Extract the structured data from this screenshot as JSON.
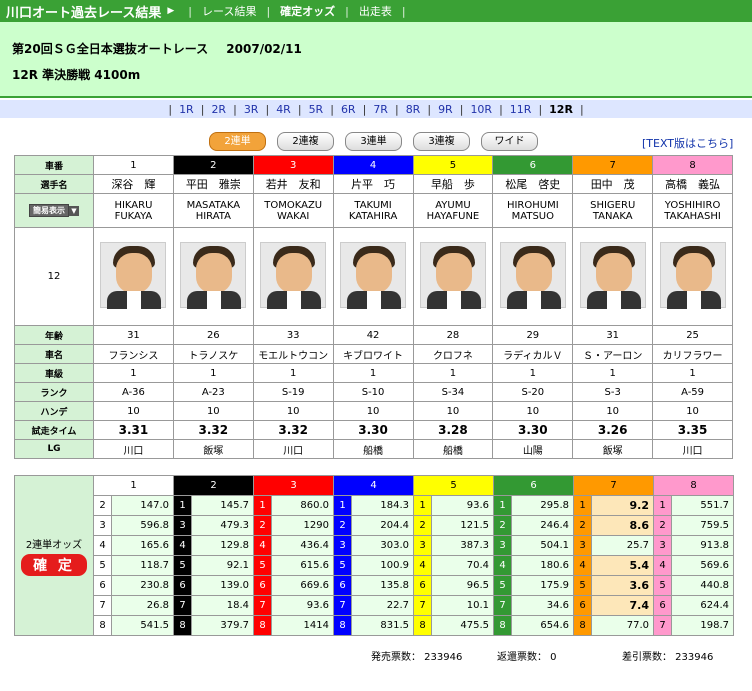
{
  "topbar": {
    "title": "川口オート過去レース結果",
    "arrow": "▶",
    "nav": [
      {
        "label": "レース結果",
        "active": false
      },
      {
        "label": "確定オッズ",
        "active": true
      },
      {
        "label": "出走表",
        "active": false
      }
    ]
  },
  "header": {
    "race_name": "第20回ＳＧ全日本選抜オートレース",
    "date": "2007/02/11",
    "race_info": "12R 準決勝戦 4100m"
  },
  "races": [
    "1R",
    "2R",
    "3R",
    "4R",
    "5R",
    "6R",
    "7R",
    "8R",
    "9R",
    "10R",
    "11R",
    "12R"
  ],
  "active_race": "12R",
  "tabs": [
    {
      "label": "2連単",
      "active": true
    },
    {
      "label": "2連複",
      "active": false
    },
    {
      "label": "3連単",
      "active": false
    },
    {
      "label": "3連複",
      "active": false
    },
    {
      "label": "ワイド",
      "active": false
    }
  ],
  "text_link": "[TEXT版はこちら]",
  "labels": {
    "car": "車番",
    "name": "選手名",
    "easy": "簡易表示",
    "easy_btn": "▼",
    "race_no": "12",
    "age": "年齢",
    "bike": "車名",
    "class": "車級",
    "rank": "ランク",
    "handicap": "ハンデ",
    "time": "試走タイム",
    "lg": "LG",
    "odds_label": "2連単オッズ",
    "kakutei": "確 定"
  },
  "colors": {
    "1": {
      "bg": "#ffffff",
      "fg": "#000000"
    },
    "2": {
      "bg": "#000000",
      "fg": "#ffffff"
    },
    "3": {
      "bg": "#ff0000",
      "fg": "#ffffff"
    },
    "4": {
      "bg": "#0000ff",
      "fg": "#ffffff"
    },
    "5": {
      "bg": "#ffff00",
      "fg": "#000000"
    },
    "6": {
      "bg": "#339933",
      "fg": "#ffffff"
    },
    "7": {
      "bg": "#ff9900",
      "fg": "#000000"
    },
    "8": {
      "bg": "#ff99cc",
      "fg": "#000000"
    }
  },
  "riders": [
    {
      "no": "1",
      "name": "深谷　輝",
      "romaji1": "HIKARU",
      "romaji2": "FUKAYA",
      "age": "31",
      "bike": "フランシス",
      "class": "1",
      "rank": "A-36",
      "handicap": "10",
      "time": "3.31",
      "lg": "川口"
    },
    {
      "no": "2",
      "name": "平田　雅崇",
      "romaji1": "MASATAKA",
      "romaji2": "HIRATA",
      "age": "26",
      "bike": "トラノスケ",
      "class": "1",
      "rank": "A-23",
      "handicap": "10",
      "time": "3.32",
      "lg": "飯塚"
    },
    {
      "no": "3",
      "name": "若井　友和",
      "romaji1": "TOMOKAZU",
      "romaji2": "WAKAI",
      "age": "33",
      "bike": "モエルトウコン",
      "class": "1",
      "rank": "S-19",
      "handicap": "10",
      "time": "3.32",
      "lg": "川口"
    },
    {
      "no": "4",
      "name": "片平　巧",
      "romaji1": "TAKUMI",
      "romaji2": "KATAHIRA",
      "age": "42",
      "bike": "キブロワイト",
      "class": "1",
      "rank": "S-10",
      "handicap": "10",
      "time": "3.30",
      "lg": "船橋"
    },
    {
      "no": "5",
      "name": "早船　歩",
      "romaji1": "AYUMU",
      "romaji2": "HAYAFUNE",
      "age": "28",
      "bike": "クロフネ",
      "class": "1",
      "rank": "S-34",
      "handicap": "10",
      "time": "3.28",
      "lg": "船橋"
    },
    {
      "no": "6",
      "name": "松尾　啓史",
      "romaji1": "HIROHUMI",
      "romaji2": "MATSUO",
      "age": "29",
      "bike": "ラディカルＶ",
      "class": "1",
      "rank": "S-20",
      "handicap": "10",
      "time": "3.30",
      "lg": "山陽"
    },
    {
      "no": "7",
      "name": "田中　茂",
      "romaji1": "SHIGERU",
      "romaji2": "TANAKA",
      "age": "31",
      "bike": "Ｓ・アーロン",
      "class": "1",
      "rank": "S-3",
      "handicap": "10",
      "time": "3.26",
      "lg": "飯塚"
    },
    {
      "no": "8",
      "name": "高橋　義弘",
      "romaji1": "YOSHIHIRO",
      "romaji2": "TAKAHASHI",
      "age": "25",
      "bike": "カリフラワー",
      "class": "1",
      "rank": "A-59",
      "handicap": "10",
      "time": "3.35",
      "lg": "川口"
    }
  ],
  "odds": [
    {
      "first": "1",
      "cells": [
        {
          "second": "2",
          "value": "147.0"
        },
        {
          "second": "3",
          "value": "596.8"
        },
        {
          "second": "4",
          "value": "165.6"
        },
        {
          "second": "5",
          "value": "118.7"
        },
        {
          "second": "6",
          "value": "230.8"
        },
        {
          "second": "7",
          "value": "26.8"
        },
        {
          "second": "8",
          "value": "541.5"
        }
      ]
    },
    {
      "first": "2",
      "cells": [
        {
          "second": "1",
          "value": "145.7"
        },
        {
          "second": "3",
          "value": "479.3"
        },
        {
          "second": "4",
          "value": "129.8"
        },
        {
          "second": "5",
          "value": "92.1"
        },
        {
          "second": "6",
          "value": "139.0"
        },
        {
          "second": "7",
          "value": "18.4"
        },
        {
          "second": "8",
          "value": "379.7"
        }
      ]
    },
    {
      "first": "3",
      "cells": [
        {
          "second": "1",
          "value": "860.0"
        },
        {
          "second": "2",
          "value": "1290"
        },
        {
          "second": "4",
          "value": "436.4"
        },
        {
          "second": "5",
          "value": "615.6"
        },
        {
          "second": "6",
          "value": "669.6"
        },
        {
          "second": "7",
          "value": "93.6"
        },
        {
          "second": "8",
          "value": "1414"
        }
      ]
    },
    {
      "first": "4",
      "cells": [
        {
          "second": "1",
          "value": "184.3"
        },
        {
          "second": "2",
          "value": "204.4"
        },
        {
          "second": "3",
          "value": "303.0"
        },
        {
          "second": "5",
          "value": "100.9"
        },
        {
          "second": "6",
          "value": "135.8"
        },
        {
          "second": "7",
          "value": "22.7"
        },
        {
          "second": "8",
          "value": "831.5"
        }
      ]
    },
    {
      "first": "5",
      "cells": [
        {
          "second": "1",
          "value": "93.6"
        },
        {
          "second": "2",
          "value": "121.5"
        },
        {
          "second": "3",
          "value": "387.3"
        },
        {
          "second": "4",
          "value": "70.4"
        },
        {
          "second": "6",
          "value": "96.5"
        },
        {
          "second": "7",
          "value": "10.1"
        },
        {
          "second": "8",
          "value": "475.5"
        }
      ]
    },
    {
      "first": "6",
      "cells": [
        {
          "second": "1",
          "value": "295.8"
        },
        {
          "second": "2",
          "value": "246.4"
        },
        {
          "second": "3",
          "value": "504.1"
        },
        {
          "second": "4",
          "value": "180.6"
        },
        {
          "second": "5",
          "value": "175.9"
        },
        {
          "second": "7",
          "value": "34.6"
        },
        {
          "second": "8",
          "value": "654.6"
        }
      ]
    },
    {
      "first": "7",
      "cells": [
        {
          "second": "1",
          "value": "9.2",
          "hl": true
        },
        {
          "second": "2",
          "value": "8.6",
          "hl": true
        },
        {
          "second": "3",
          "value": "25.7"
        },
        {
          "second": "4",
          "value": "5.4",
          "hl": true
        },
        {
          "second": "5",
          "value": "3.6",
          "hl": true
        },
        {
          "second": "6",
          "value": "7.4",
          "hl": true
        },
        {
          "second": "8",
          "value": "77.0"
        }
      ]
    },
    {
      "first": "8",
      "cells": [
        {
          "second": "1",
          "value": "551.7"
        },
        {
          "second": "2",
          "value": "759.5"
        },
        {
          "second": "3",
          "value": "913.8"
        },
        {
          "second": "4",
          "value": "569.6"
        },
        {
          "second": "5",
          "value": "440.8"
        },
        {
          "second": "6",
          "value": "624.4"
        },
        {
          "second": "7",
          "value": "198.7"
        }
      ]
    }
  ],
  "footer": {
    "sales": "発売票数： 233946",
    "refund": "返還票数： 0",
    "net": "差引票数： 233946"
  }
}
